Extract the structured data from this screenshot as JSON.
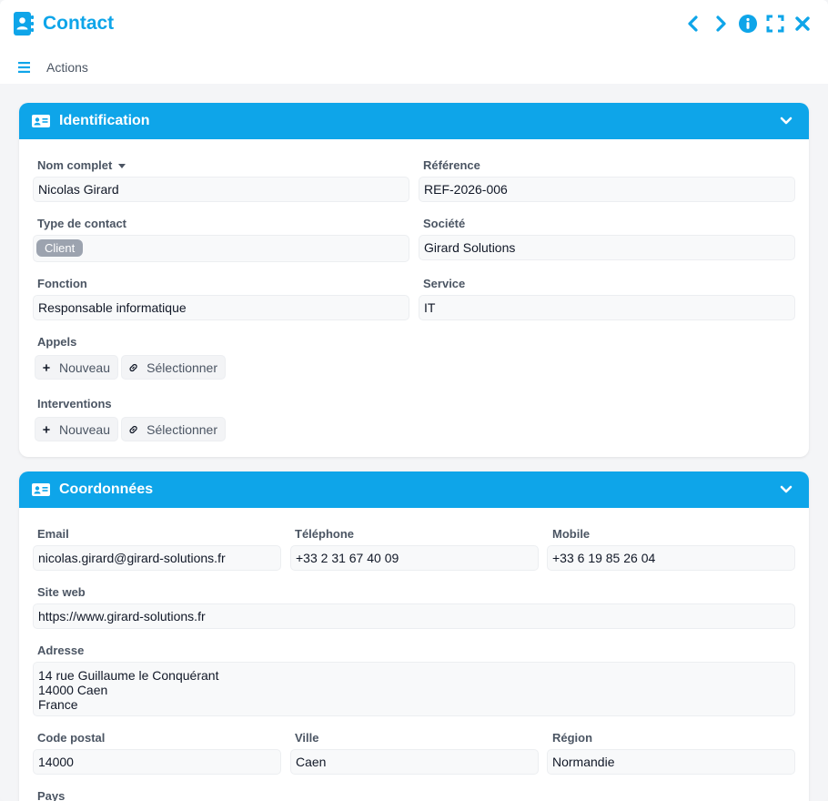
{
  "window": {
    "title": "Contact"
  },
  "menu": {
    "actions_label": "Actions"
  },
  "identification": {
    "title": "Identification",
    "nom_complet": {
      "label": "Nom complet",
      "value": "Nicolas Girard"
    },
    "reference": {
      "label": "Référence",
      "value": "REF-2026-006"
    },
    "type_contact": {
      "label": "Type de contact",
      "badge": "Client"
    },
    "societe": {
      "label": "Société",
      "value": "Girard Solutions"
    },
    "fonction": {
      "label": "Fonction",
      "value": "Responsable informatique"
    },
    "service": {
      "label": "Service",
      "value": "IT"
    },
    "appels": {
      "label": "Appels",
      "new_label": "Nouveau",
      "select_label": "Sélectionner"
    },
    "interventions": {
      "label": "Interventions",
      "new_label": "Nouveau",
      "select_label": "Sélectionner"
    }
  },
  "coordonnees": {
    "title": "Coordonnées",
    "email": {
      "label": "Email",
      "value": "nicolas.girard@girard-solutions.fr"
    },
    "telephone": {
      "label": "Téléphone",
      "value": "+33 2 31 67 40 09"
    },
    "mobile": {
      "label": "Mobile",
      "value": "+33 6 19 85 26 04"
    },
    "site_web": {
      "label": "Site web",
      "value": "https://www.girard-solutions.fr"
    },
    "adresse": {
      "label": "Adresse",
      "line1": "14 rue Guillaume le Conquérant",
      "line2": "14000 Caen",
      "line3": "France"
    },
    "code_postal": {
      "label": "Code postal",
      "value": "14000"
    },
    "ville": {
      "label": "Ville",
      "value": "Caen"
    },
    "region": {
      "label": "Région",
      "value": "Normandie"
    },
    "pays": {
      "label": "Pays"
    }
  },
  "colors": {
    "accent": "#0ea5e9",
    "badge": "#9ca3af"
  }
}
